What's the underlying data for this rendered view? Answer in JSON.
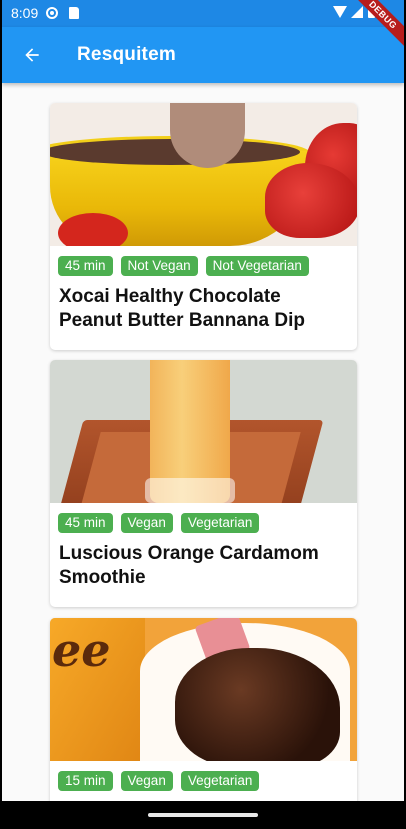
{
  "status_bar": {
    "time": "8:09",
    "icons": [
      "settings-icon",
      "sd-card-icon",
      "wifi-icon",
      "signal-icon",
      "battery-icon"
    ]
  },
  "app_bar": {
    "title": "Resquitem",
    "back_icon": "arrow-left-icon"
  },
  "debug_banner": "DEBUG",
  "recipes": [
    {
      "image": "chocolate-dip-image",
      "tags": [
        "45 min",
        "Not Vegan",
        "Not Vegetarian"
      ],
      "title": "Xocai Healthy Chocolate Peanut Butter Bannana Dip"
    },
    {
      "image": "orange-smoothie-image",
      "tags": [
        "45 min",
        "Vegan",
        "Vegetarian"
      ],
      "title": "Luscious Orange Cardamom Smoothie"
    },
    {
      "image": "chocolate-cups-image",
      "tags": [
        "15 min",
        "Vegan",
        "Vegetarian"
      ],
      "title": ""
    }
  ],
  "colors": {
    "app_bar": "#2196f3",
    "status_bar": "#1e88e5",
    "tag": "#4caf50",
    "debug": "#b71c1c"
  }
}
